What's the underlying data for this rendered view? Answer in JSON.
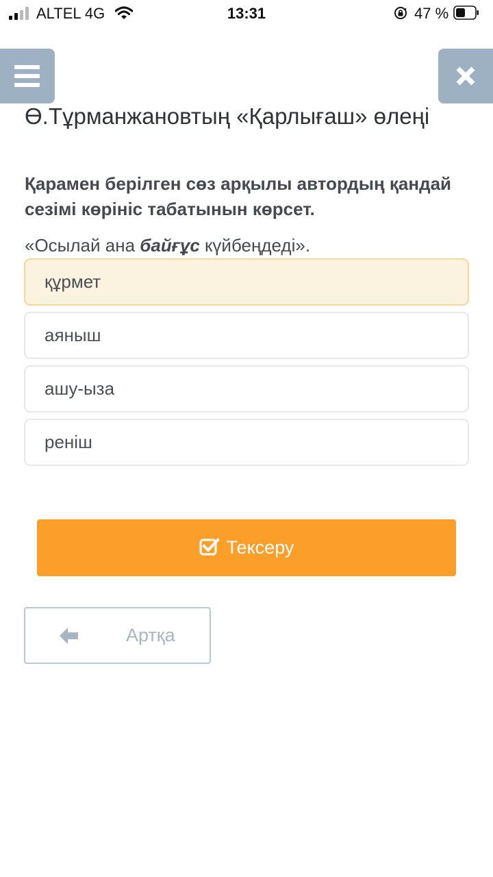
{
  "status_bar": {
    "carrier": "ALTEL 4G",
    "time": "13:31",
    "battery": "47 %"
  },
  "header": {
    "title": "Ө.Тұрманжановтың «Қарлығаш» өлеңі"
  },
  "question": {
    "text": "Қарамен берілген сөз арқылы автордың қандай сезімі көрініс табатынын көрсет.",
    "quote_before": "«Осылай ана ",
    "quote_bold": "байғұс",
    "quote_after": " күйбеңдеді»."
  },
  "options": [
    {
      "label": "құрмет",
      "selected": true
    },
    {
      "label": "аяныш",
      "selected": false
    },
    {
      "label": "ашу-ыза",
      "selected": false
    },
    {
      "label": "реніш",
      "selected": false
    }
  ],
  "buttons": {
    "check_label": "Тексеру",
    "back_label": "Артқа"
  },
  "colors": {
    "accent": "#fc9f2a",
    "nav_button": "#9db1c3",
    "selected_bg": "#fbf2e0"
  },
  "icons": {
    "menu": "hamburger-icon",
    "close": "close-icon",
    "check": "checkbox-check-icon",
    "back": "arrow-left-icon"
  }
}
